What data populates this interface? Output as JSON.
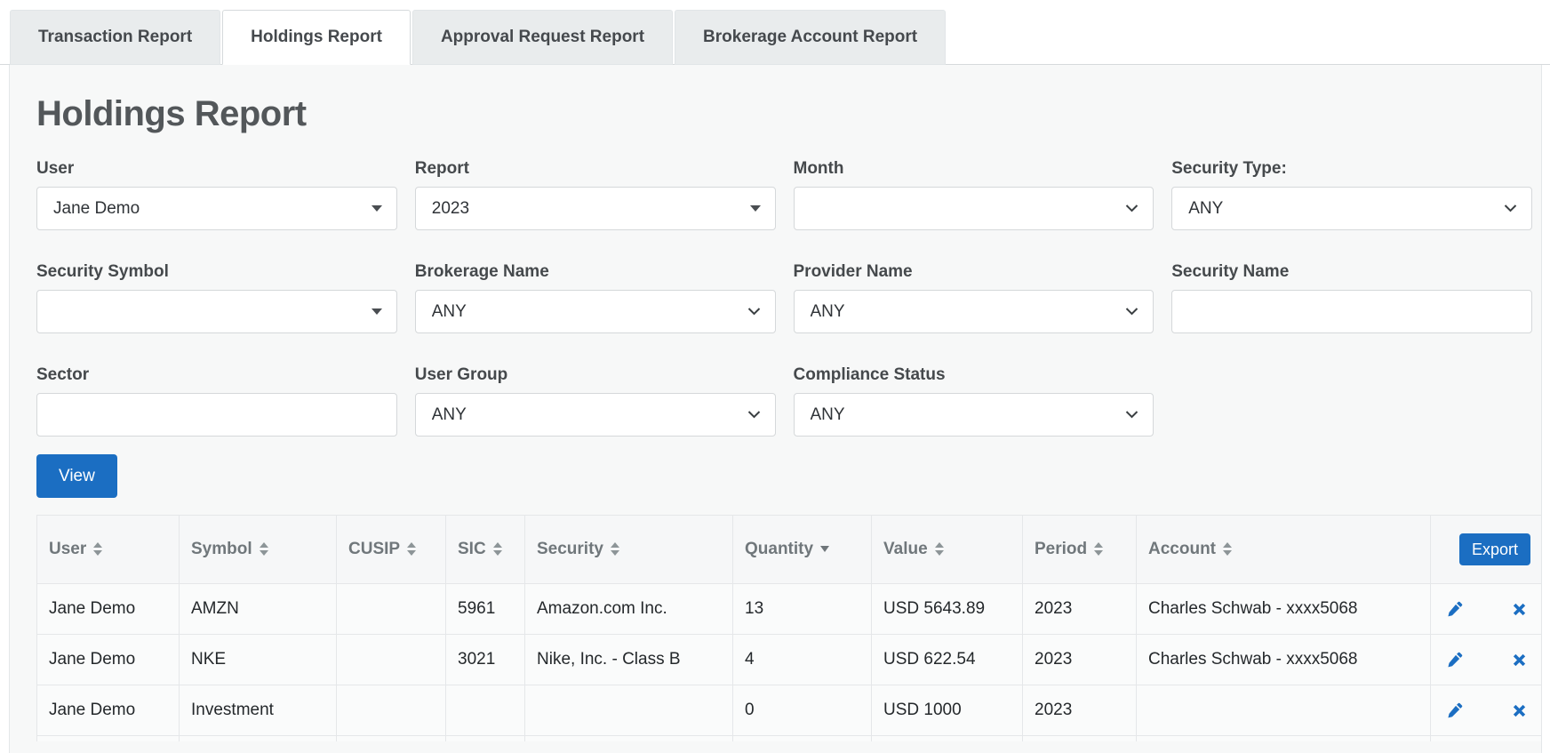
{
  "tabs": [
    {
      "label": "Transaction Report",
      "active": false
    },
    {
      "label": "Holdings Report",
      "active": true
    },
    {
      "label": "Approval Request Report",
      "active": false
    },
    {
      "label": "Brokerage Account Report",
      "active": false
    }
  ],
  "page": {
    "title": "Holdings Report"
  },
  "filters": {
    "fields": [
      {
        "label": "User",
        "type": "combo",
        "value": "Jane Demo"
      },
      {
        "label": "Report",
        "type": "combo",
        "value": "2023"
      },
      {
        "label": "Month",
        "type": "select",
        "value": ""
      },
      {
        "label": "Security Type:",
        "type": "select",
        "value": "ANY"
      },
      {
        "label": "Security Symbol",
        "type": "combo",
        "value": ""
      },
      {
        "label": "Brokerage Name",
        "type": "select",
        "value": "ANY"
      },
      {
        "label": "Provider Name",
        "type": "select",
        "value": "ANY"
      },
      {
        "label": "Security Name",
        "type": "text",
        "value": ""
      },
      {
        "label": "Sector",
        "type": "text",
        "value": ""
      },
      {
        "label": "User Group",
        "type": "select",
        "value": "ANY"
      },
      {
        "label": "Compliance Status",
        "type": "select",
        "value": "ANY"
      }
    ],
    "view_button": "View"
  },
  "table": {
    "export_button": "Export",
    "columns": [
      {
        "label": "User",
        "sort": "both"
      },
      {
        "label": "Symbol",
        "sort": "both"
      },
      {
        "label": "CUSIP",
        "sort": "both"
      },
      {
        "label": "SIC",
        "sort": "both"
      },
      {
        "label": "Security",
        "sort": "both"
      },
      {
        "label": "Quantity",
        "sort": "desc"
      },
      {
        "label": "Value",
        "sort": "both"
      },
      {
        "label": "Period",
        "sort": "both"
      },
      {
        "label": "Account",
        "sort": "both"
      },
      {
        "label": "",
        "sort": "none"
      }
    ],
    "rows": [
      {
        "user": "Jane Demo",
        "symbol": "AMZN",
        "cusip": "",
        "sic": "5961",
        "security": "Amazon.com Inc.",
        "quantity": "13",
        "value": "USD 5643.89",
        "period": "2023",
        "account": "Charles Schwab - xxxx5068"
      },
      {
        "user": "Jane Demo",
        "symbol": "NKE",
        "cusip": "",
        "sic": "3021",
        "security": "Nike, Inc. - Class B",
        "quantity": "4",
        "value": "USD 622.54",
        "period": "2023",
        "account": "Charles Schwab - xxxx5068"
      },
      {
        "user": "Jane Demo",
        "symbol": "Investment",
        "cusip": "",
        "sic": "",
        "security": "",
        "quantity": "0",
        "value": "USD 1000",
        "period": "2023",
        "account": ""
      }
    ]
  },
  "colors": {
    "accent": "#1b6ec2",
    "tab_inactive_bg": "#e9eced",
    "content_bg": "#f7f8f8",
    "border": "#d6dadc",
    "heading_text": "#53575a",
    "table_header_text": "#70777b"
  }
}
